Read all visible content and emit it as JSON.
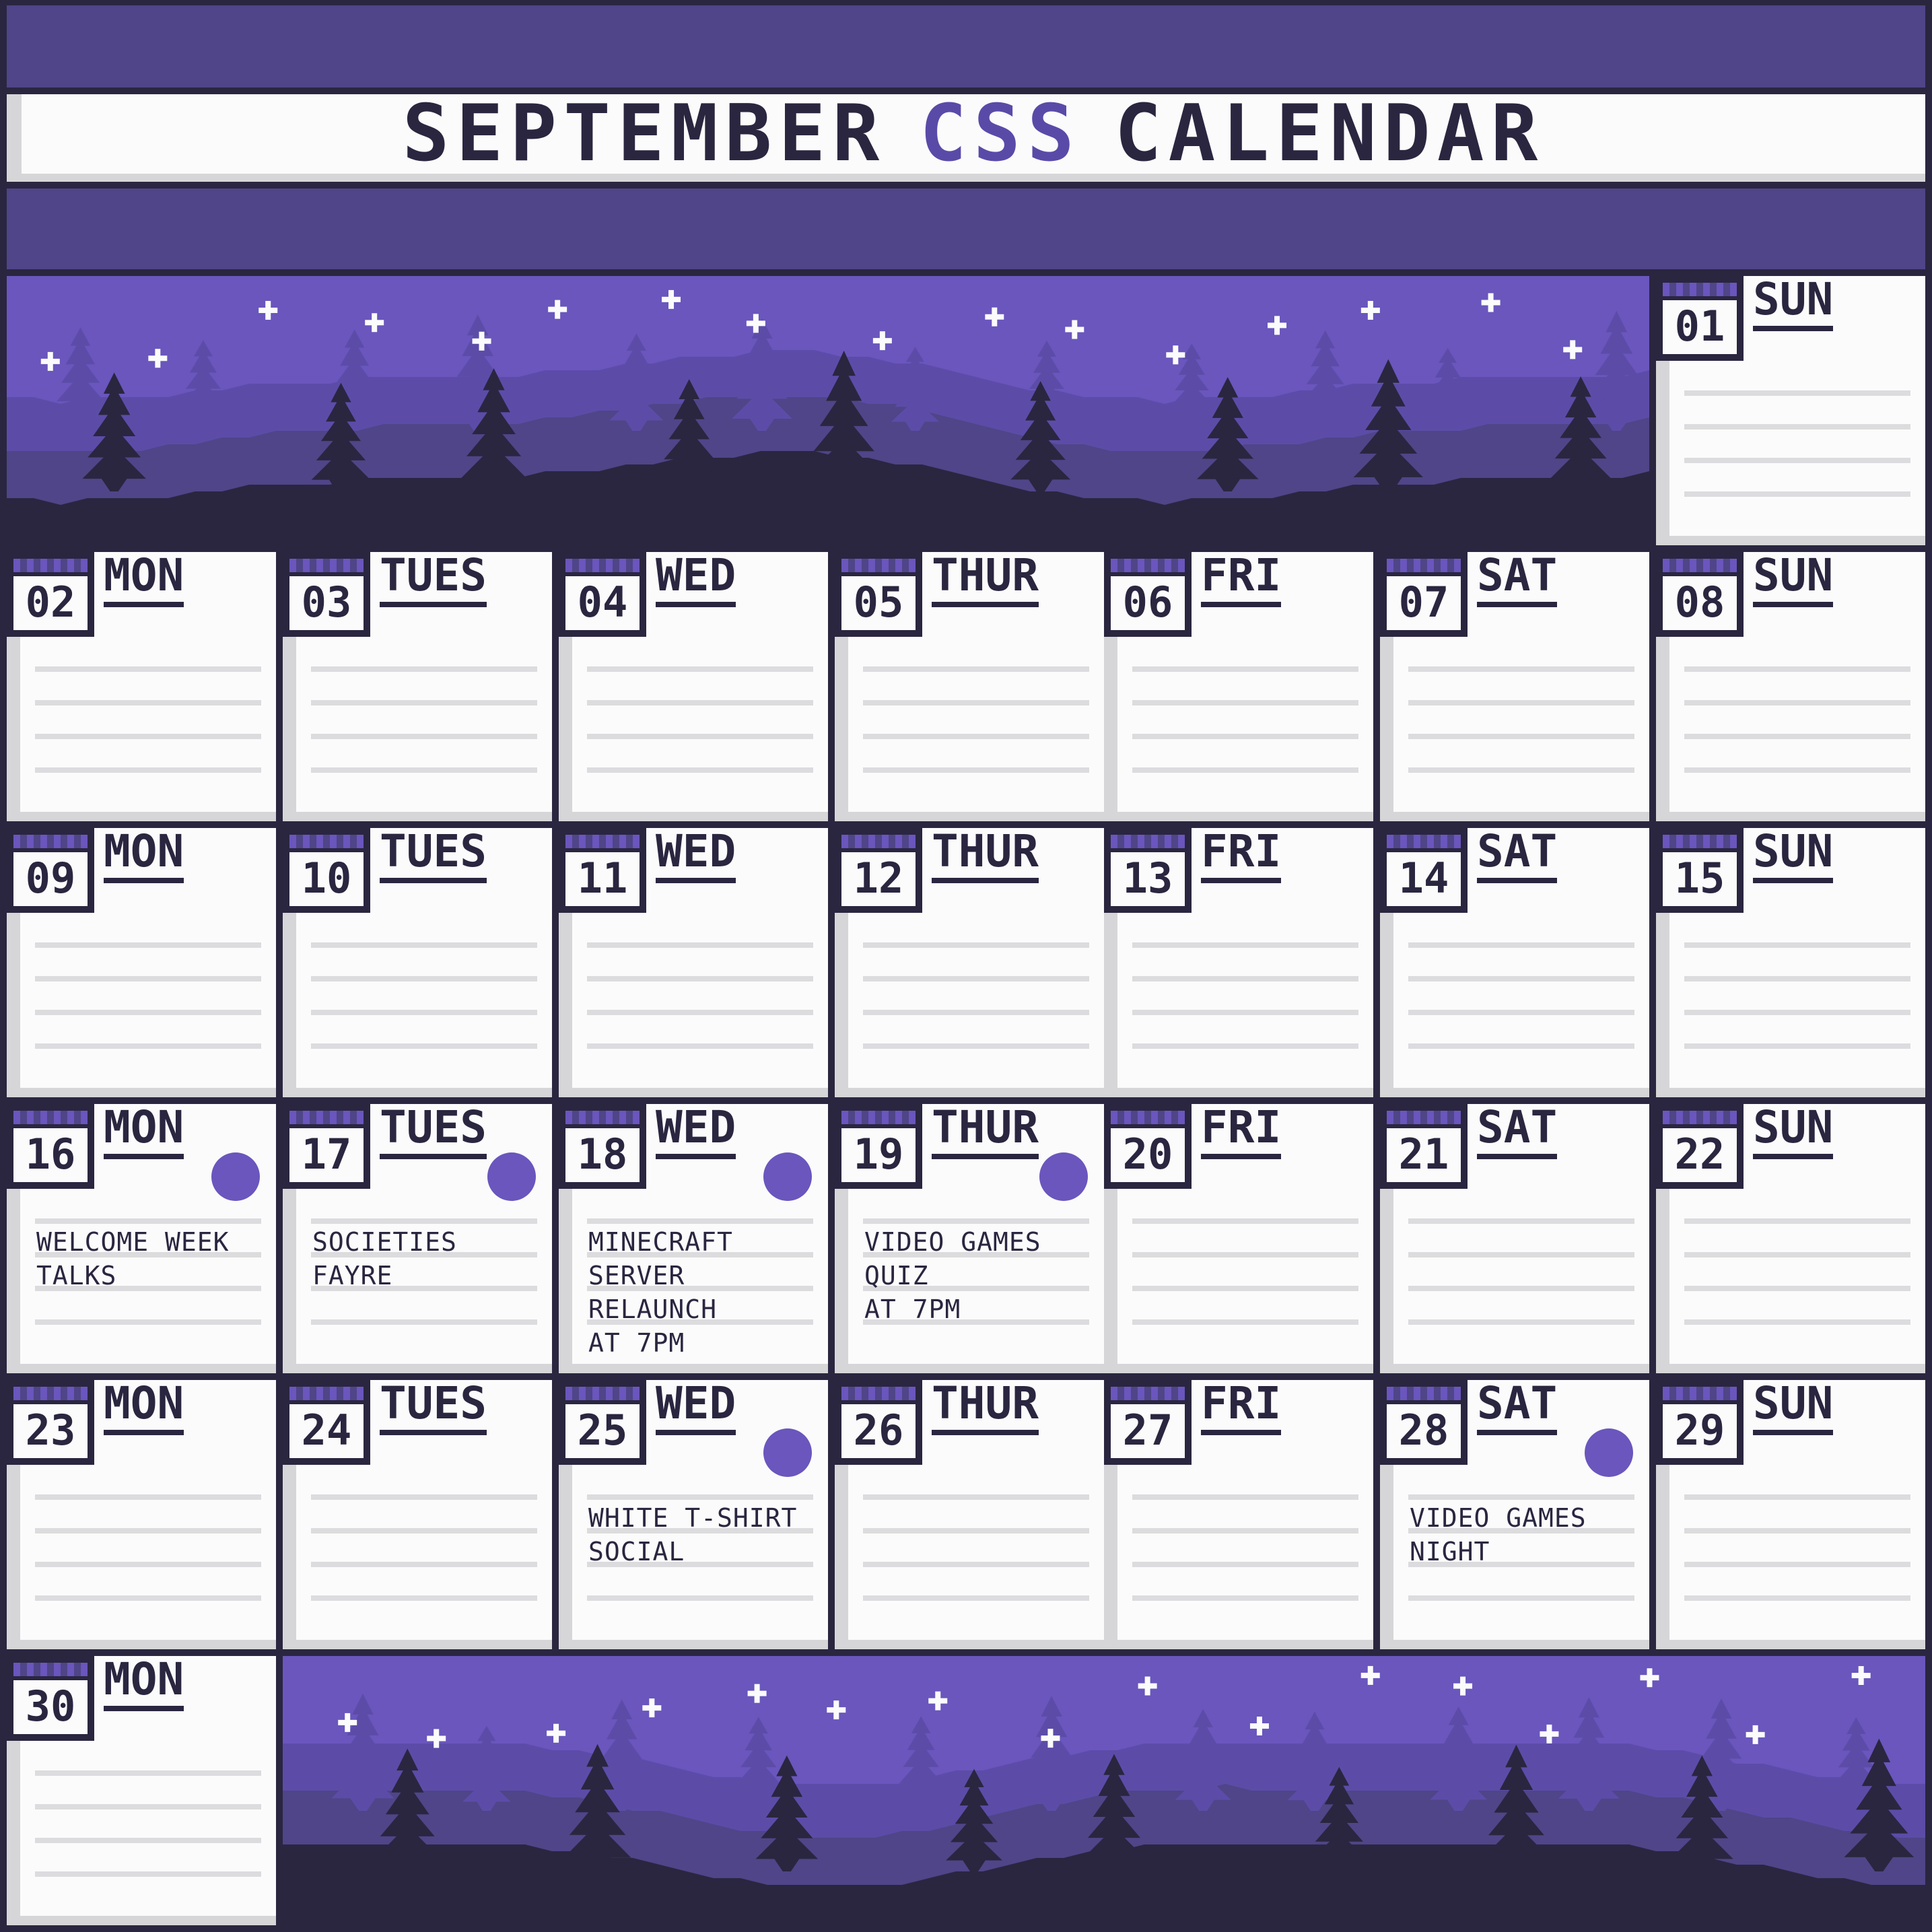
{
  "header": {
    "title_part1": "SEPTEMBER",
    "title_accent": "CSS",
    "title_part2": "CALENDAR"
  },
  "colors": {
    "accent": "#6a56bd",
    "band": "#4f4588",
    "dark": "#2a2640",
    "paper": "#fbfbfb"
  },
  "days": [
    {
      "num": "01",
      "name": "SUN",
      "event": "",
      "dot": false
    },
    {
      "num": "02",
      "name": "MON",
      "event": "",
      "dot": false
    },
    {
      "num": "03",
      "name": "TUES",
      "event": "",
      "dot": false
    },
    {
      "num": "04",
      "name": "WED",
      "event": "",
      "dot": false
    },
    {
      "num": "05",
      "name": "THUR",
      "event": "",
      "dot": false
    },
    {
      "num": "06",
      "name": "FRI",
      "event": "",
      "dot": false
    },
    {
      "num": "07",
      "name": "SAT",
      "event": "",
      "dot": false
    },
    {
      "num": "08",
      "name": "SUN",
      "event": "",
      "dot": false
    },
    {
      "num": "09",
      "name": "MON",
      "event": "",
      "dot": false
    },
    {
      "num": "10",
      "name": "TUES",
      "event": "",
      "dot": false
    },
    {
      "num": "11",
      "name": "WED",
      "event": "",
      "dot": false
    },
    {
      "num": "12",
      "name": "THUR",
      "event": "",
      "dot": false
    },
    {
      "num": "13",
      "name": "FRI",
      "event": "",
      "dot": false
    },
    {
      "num": "14",
      "name": "SAT",
      "event": "",
      "dot": false
    },
    {
      "num": "15",
      "name": "SUN",
      "event": "",
      "dot": false
    },
    {
      "num": "16",
      "name": "MON",
      "event": "WELCOME WEEK\nTALKS",
      "dot": true
    },
    {
      "num": "17",
      "name": "TUES",
      "event": "SOCIETIES FAYRE",
      "dot": true
    },
    {
      "num": "18",
      "name": "WED",
      "event": "MINECRAFT\nSERVER RELAUNCH\nAT 7PM",
      "dot": true
    },
    {
      "num": "19",
      "name": "THUR",
      "event": "VIDEO GAMES\nQUIZ\nAT 7PM",
      "dot": true
    },
    {
      "num": "20",
      "name": "FRI",
      "event": "",
      "dot": false
    },
    {
      "num": "21",
      "name": "SAT",
      "event": "",
      "dot": false
    },
    {
      "num": "22",
      "name": "SUN",
      "event": "",
      "dot": false
    },
    {
      "num": "23",
      "name": "MON",
      "event": "",
      "dot": false
    },
    {
      "num": "24",
      "name": "TUES",
      "event": "",
      "dot": false
    },
    {
      "num": "25",
      "name": "WED",
      "event": "WHITE T-SHIRT\nSOCIAL",
      "dot": true
    },
    {
      "num": "26",
      "name": "THUR",
      "event": "",
      "dot": false
    },
    {
      "num": "27",
      "name": "FRI",
      "event": "",
      "dot": false
    },
    {
      "num": "28",
      "name": "SAT",
      "event": "VIDEO GAMES\nNIGHT",
      "dot": true
    },
    {
      "num": "29",
      "name": "SUN",
      "event": "",
      "dot": false
    },
    {
      "num": "30",
      "name": "MON",
      "event": "",
      "dot": false
    }
  ]
}
